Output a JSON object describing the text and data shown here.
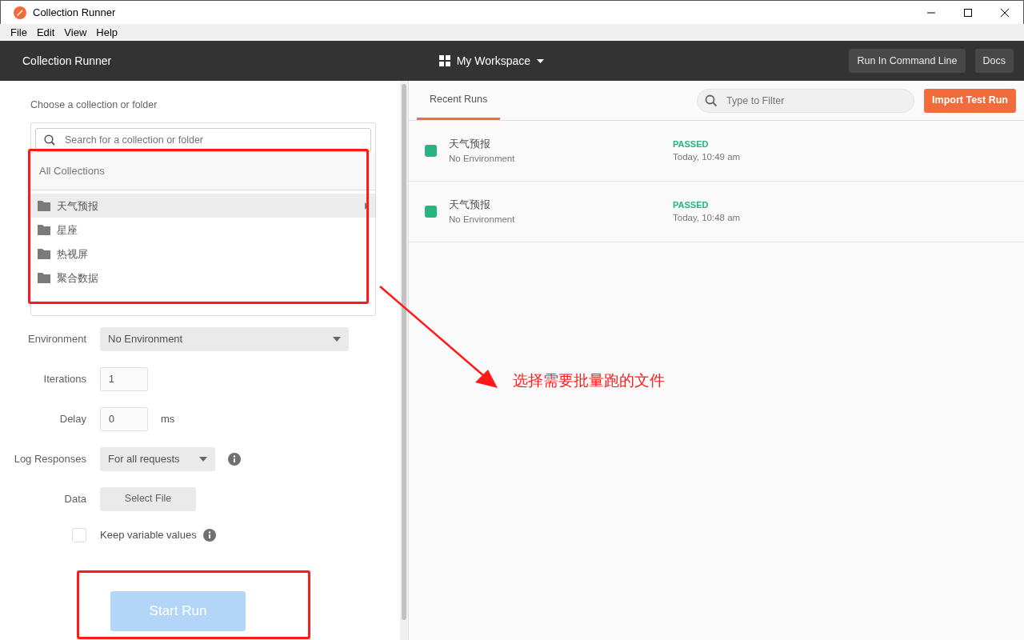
{
  "window": {
    "title": "Collection Runner"
  },
  "menu": [
    "File",
    "Edit",
    "View",
    "Help"
  ],
  "header": {
    "title": "Collection Runner",
    "workspace": "My Workspace",
    "buttons": [
      "Run In Command Line",
      "Docs"
    ]
  },
  "chooser": {
    "label": "Choose a collection or folder",
    "search": {
      "placeholder": "Search for a collection or folder"
    },
    "heading": "All Collections",
    "items": [
      {
        "label": "天气预报",
        "selected": true
      },
      {
        "label": "星座",
        "selected": false
      },
      {
        "label": "热视屏",
        "selected": false
      },
      {
        "label": "聚合数据",
        "selected": false
      }
    ]
  },
  "settings": {
    "environment": {
      "label": "Environment",
      "value": "No Environment"
    },
    "iterations": {
      "label": "Iterations",
      "value": "1"
    },
    "delay": {
      "label": "Delay",
      "value": "0",
      "unit": "ms"
    },
    "log_responses": {
      "label": "Log Responses",
      "value": "For all requests"
    },
    "data": {
      "label": "Data",
      "button": "Select File"
    },
    "keep_variables": {
      "label": "Keep variable values",
      "checked": false
    },
    "start_button": {
      "label": "Start Run",
      "disabled": true
    }
  },
  "runs_panel": {
    "tabs": [
      {
        "label": "Recent Runs",
        "selected": true
      }
    ],
    "filter": {
      "placeholder": "Type to Filter"
    },
    "import_button": "Import Test Run",
    "runs": [
      {
        "name": "天气预报",
        "environment": "No Environment",
        "status": "PASSED",
        "time": "Today, 10:49 am",
        "color": "#26b47f"
      },
      {
        "name": "天气预报",
        "environment": "No Environment",
        "status": "PASSED",
        "time": "Today, 10:48 am",
        "color": "#26b47f"
      }
    ]
  },
  "annotation": {
    "text": "选择需要批量跑的文件"
  }
}
